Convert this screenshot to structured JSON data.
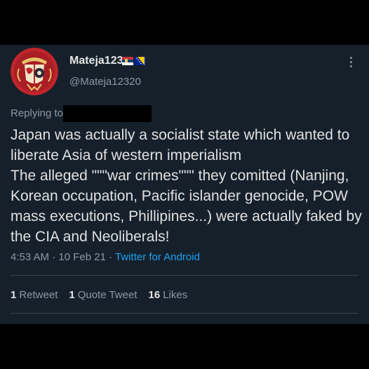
{
  "tweet": {
    "display_name": "Mateja123",
    "handle": "@Mateja12320",
    "avatar_icon": "heraldic-coat-of-arms-icon",
    "flags": [
      "serbia-flag-icon",
      "bosnia-flag-icon"
    ],
    "more_icon": "more-options-icon",
    "replying_to": "Replying to",
    "text_lines": [
      "Japan was actually a socialist state which wanted to",
      "liberate Asia of western imperialism",
      "The alleged \"\"\"war crimes\"\"\" they comitted (Nanjing,",
      "Korean occupation, Pacific islander genocide, POW",
      "mass executions, Phillipines...) were actually faked by",
      "the CIA and Neoliberals!"
    ],
    "time": "4:53 AM",
    "date": "10 Feb 21",
    "source": "Twitter for Android",
    "separator": "·",
    "stats": {
      "retweets_count": "1",
      "retweets_label": "Retweet",
      "quotes_count": "1",
      "quotes_label": "Quote Tweet",
      "likes_count": "16",
      "likes_label": "Likes"
    }
  },
  "colors": {
    "background": "#15202b",
    "border": "#38444d",
    "text": "#e1e1e1",
    "secondary": "#8899a6",
    "link": "#1da1f2",
    "avatar_bg": "#c0252b"
  }
}
